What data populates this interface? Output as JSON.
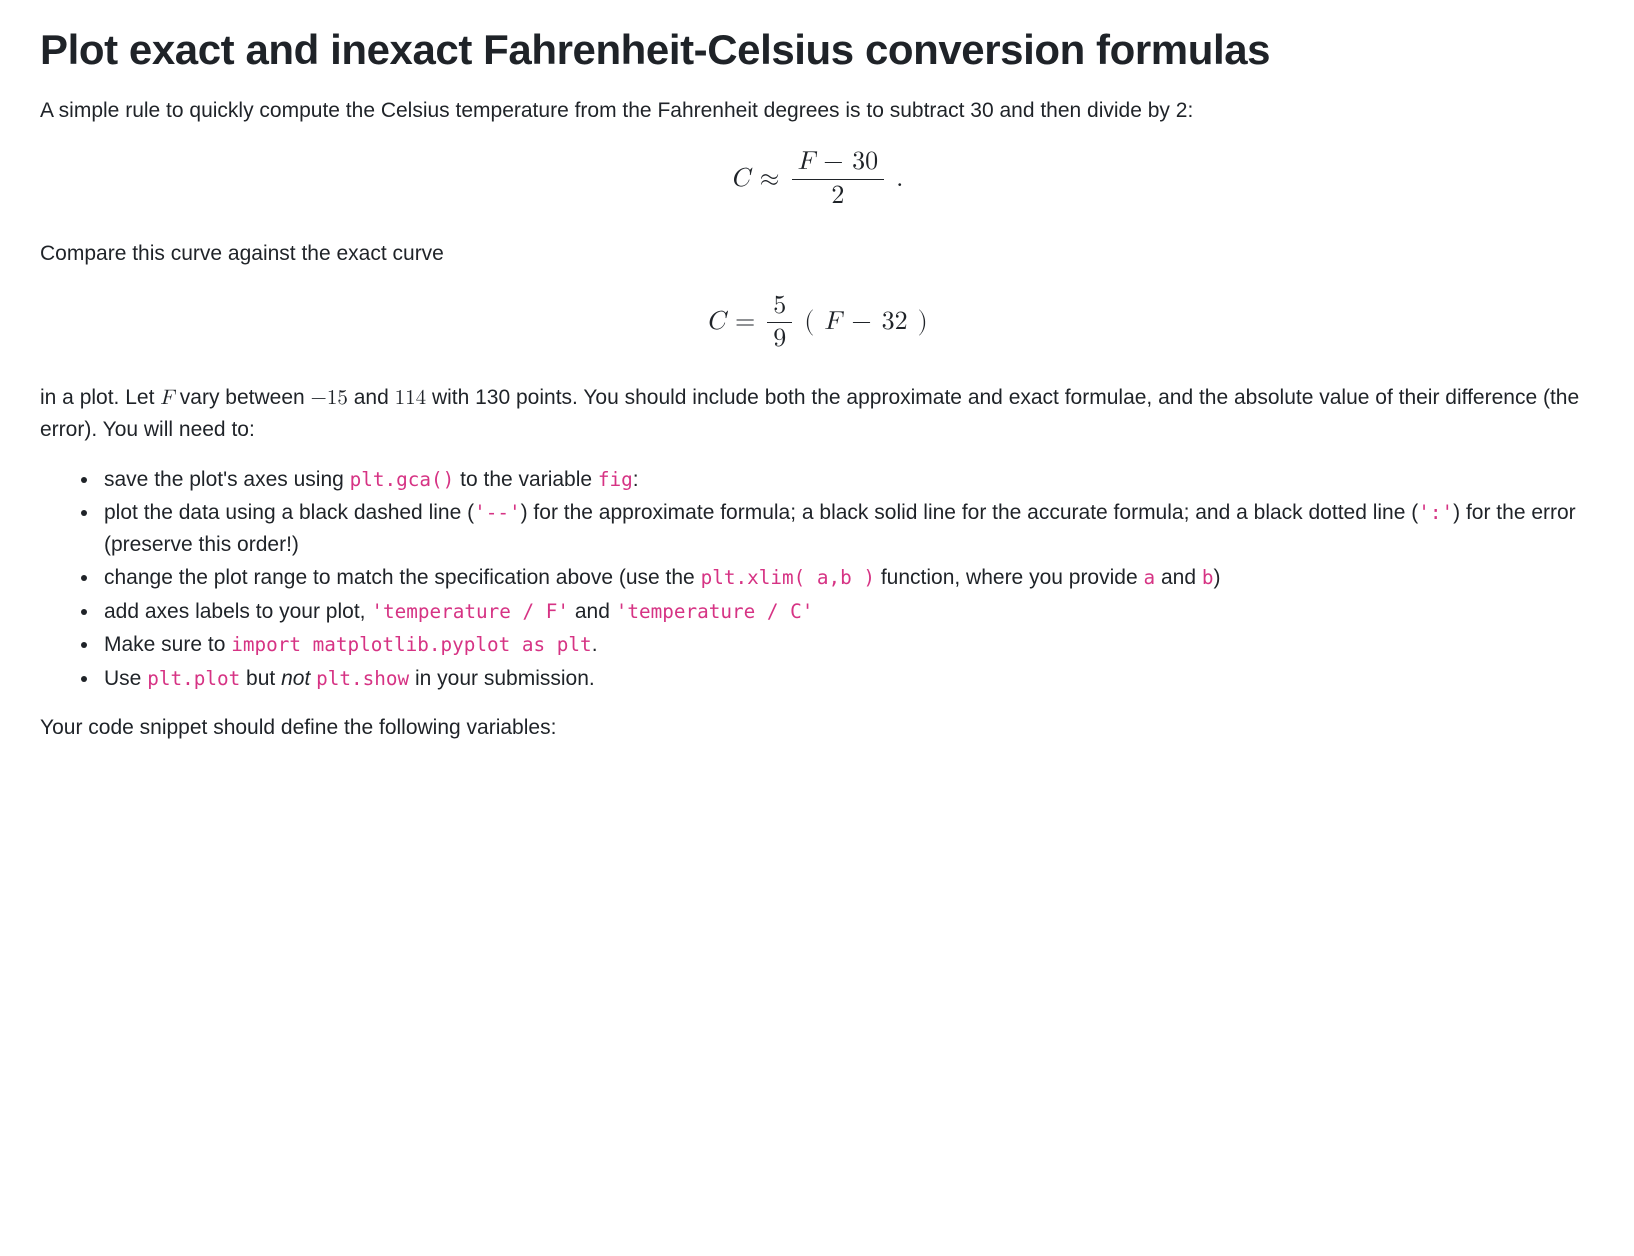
{
  "title": "Plot exact and inexact Fahrenheit-Celsius conversion formulas",
  "intro": "A simple rule to quickly compute the Celsius temperature from the Fahrenheit degrees is to subtract 30 and then divide by 2:",
  "eq1": {
    "lhs_var": "C",
    "rel": "≈",
    "num_left_var": "F",
    "num_minus": "−",
    "num_right": "30",
    "den": "2",
    "trail": "."
  },
  "compare_line": "Compare this curve against the exact curve",
  "eq2": {
    "lhs_var": "C",
    "rel": "=",
    "frac_num": "5",
    "frac_den": "9",
    "open": "(",
    "inner_var": "F",
    "minus": "−",
    "inner_num": "32",
    "close": ")"
  },
  "after_eq_pre": "in a plot. Let ",
  "after_eq_F": "F",
  "after_eq_mid1": " vary between ",
  "neg15": "−15",
  "after_eq_mid2": " and ",
  "v114": "114",
  "after_eq_post": " with 130 points. You should include both the approximate and exact formulae, and the absolute value of their difference (the error). You will need to:",
  "bullets": {
    "b1": {
      "t1": "save the plot's axes using ",
      "c1": "plt.gca()",
      "t2": " to the variable ",
      "c2": "fig",
      "t3": ":"
    },
    "b2": {
      "t1": "plot the data using a black dashed line (",
      "c1": "'--'",
      "t2": ") for the approximate formula; a black solid line for the accurate formula; and a black dotted line (",
      "c2": "':'",
      "t3": ") for the error (preserve this order!)"
    },
    "b3": {
      "t1": "change the plot range to match the specification above (use the ",
      "c1": "plt.xlim( a,b )",
      "t2": " function, where you provide ",
      "c2": "a",
      "t3": " and ",
      "c3": "b",
      "t4": ")"
    },
    "b4": {
      "t1": "add axes labels to your plot, ",
      "c1": "'temperature / F'",
      "t2": " and ",
      "c2": "'temperature / C'"
    },
    "b5": {
      "t1": "Make sure to ",
      "c1": "import matplotlib.pyplot as plt",
      "t2": "."
    },
    "b6": {
      "t1": "Use ",
      "c1": "plt.plot",
      "t2": " but ",
      "it": "not",
      "t3": " ",
      "c2": "plt.show",
      "t4": " in your submission."
    }
  },
  "closing": "Your code snippet should define the following variables:"
}
